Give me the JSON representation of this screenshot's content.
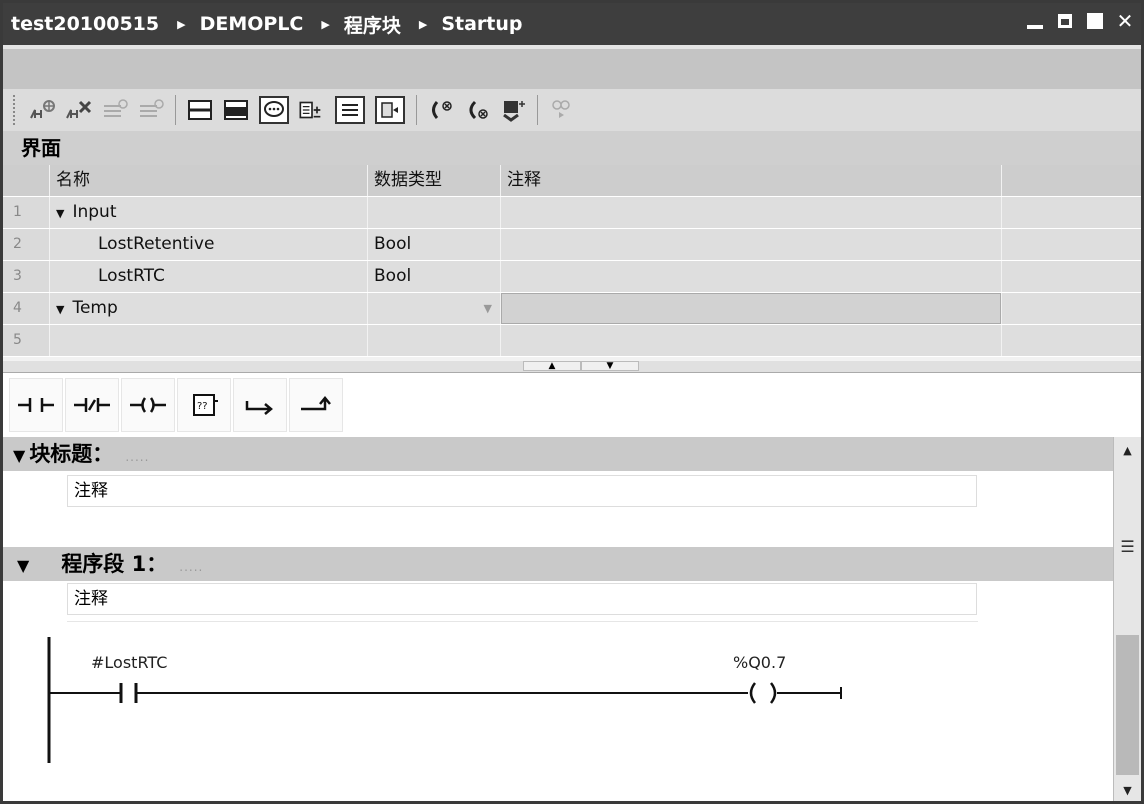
{
  "titlebar": {
    "crumbs": [
      "test20100515",
      "DEMOPLC",
      "程序块",
      "Startup"
    ],
    "separator": "▶"
  },
  "interface": {
    "title": "界面",
    "columns": {
      "name": "名称",
      "type": "数据类型",
      "comment": "注释"
    },
    "rows": [
      {
        "num": "1",
        "name": "Input",
        "type": "",
        "expandable": true
      },
      {
        "num": "2",
        "name": "LostRetentive",
        "type": "Bool",
        "expandable": false
      },
      {
        "num": "3",
        "name": "LostRTC",
        "type": "Bool",
        "expandable": false
      },
      {
        "num": "4",
        "name": "Temp",
        "type": "",
        "expandable": true
      },
      {
        "num": "5",
        "name": "",
        "type": "",
        "expandable": false
      }
    ]
  },
  "block": {
    "title": "块标题：",
    "dots": ".....",
    "comment": "注释"
  },
  "network": {
    "title": "程序段 1：",
    "dots": ".....",
    "comment": "注释",
    "contact_operand": "#LostRTC",
    "coil_operand": "%Q0.7"
  },
  "icons": {
    "toolbar": [
      "insert-network-icon",
      "delete-network-icon",
      "insert-row-icon",
      "add-row-icon",
      "collapse-all-icon",
      "expand-all-icon",
      "comment-toggle-icon",
      "absolute-operand-icon",
      "show-favorites-icon",
      "favorites-icon",
      "go-to-error-prev-icon",
      "go-to-error-next-icon",
      "monitor-icon",
      "monitor-on-off-icon"
    ],
    "lad": [
      "no-contact-icon",
      "nc-contact-icon",
      "coil-icon",
      "empty-box-icon",
      "open-branch-icon",
      "close-branch-icon"
    ]
  }
}
